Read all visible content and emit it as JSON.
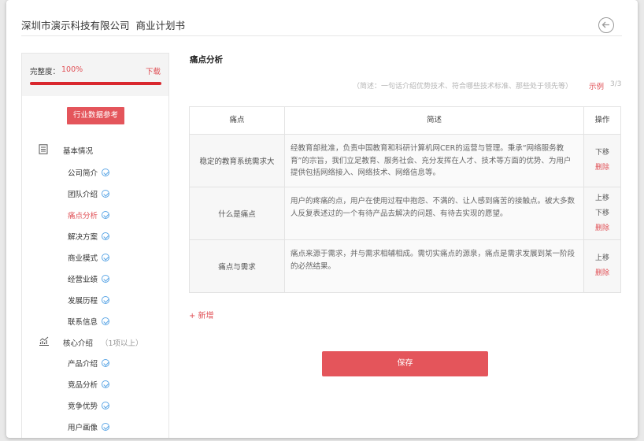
{
  "header": {
    "company": "深圳市演示科技有限公司",
    "doc_title": "商业计划书",
    "back_icon": "arrow-left-circle-icon"
  },
  "sidebar": {
    "progress_label": "完整度：",
    "progress_value": "100%",
    "progress_fraction": 1.0,
    "download_label": "下载",
    "reference_button": "行业数据参考",
    "sections": [
      {
        "icon": "document-list-icon",
        "label": "基本情况",
        "hint": "",
        "items": [
          {
            "label": "公司简介",
            "active": false
          },
          {
            "label": "团队介绍",
            "active": false
          },
          {
            "label": "痛点分析",
            "active": true
          },
          {
            "label": "解决方案",
            "active": false
          },
          {
            "label": "商业模式",
            "active": false
          },
          {
            "label": "经营业绩",
            "active": false
          },
          {
            "label": "发展历程",
            "active": false
          },
          {
            "label": "联系信息",
            "active": false
          }
        ]
      },
      {
        "icon": "trend-chart-icon",
        "label": "核心介绍",
        "hint": "（1项以上）",
        "items": [
          {
            "label": "产品介绍",
            "active": false
          },
          {
            "label": "竞品分析",
            "active": false
          },
          {
            "label": "竞争优势",
            "active": false
          },
          {
            "label": "用户画像",
            "active": false
          }
        ]
      }
    ]
  },
  "main": {
    "title": "痛点分析",
    "hint": "（简述：一句话介绍优势技术、符合哪些技术标准、那些处于领先等）",
    "example_label": "示例",
    "page_count": "3/3",
    "table": {
      "headers": [
        "痛点",
        "简述",
        "操作"
      ],
      "rows": [
        {
          "pain_point": "稳定的教育系统需求大",
          "description": "经教育部批准，负责中国教育和科研计算机网CER的运营与管理。秉承“网络服务教育”的宗旨，我们立足教育、服务社会、充分发挥在人才、技术等方面的优势、为用户提供包括网络接入、网络技术、网络信息等。",
          "ops": [
            "下移",
            "删除"
          ]
        },
        {
          "pain_point": "什么是痛点",
          "description": "用户的疼痛的点，用户在使用过程中抱怨、不满的、让人感到痛苦的接触点。被大多数人反复表述过的一个有待产品去解决的问题、有待去实现的愿望。",
          "ops": [
            "上移",
            "下移",
            "删除"
          ]
        },
        {
          "pain_point": "痛点与需求",
          "description": "痛点来源于需求，并与需求相辅相成。需切实痛点的源泉，痛点是需求发展到某一阶段的必然结果。",
          "ops": [
            "上移",
            "删除"
          ]
        }
      ]
    },
    "add_label": "+ 新增",
    "save_label": "保存"
  },
  "colors": {
    "accent": "#e4555b",
    "accent_text": "#e04f55",
    "progress_fill": "#d9272e",
    "check": "#5fa8e6"
  }
}
